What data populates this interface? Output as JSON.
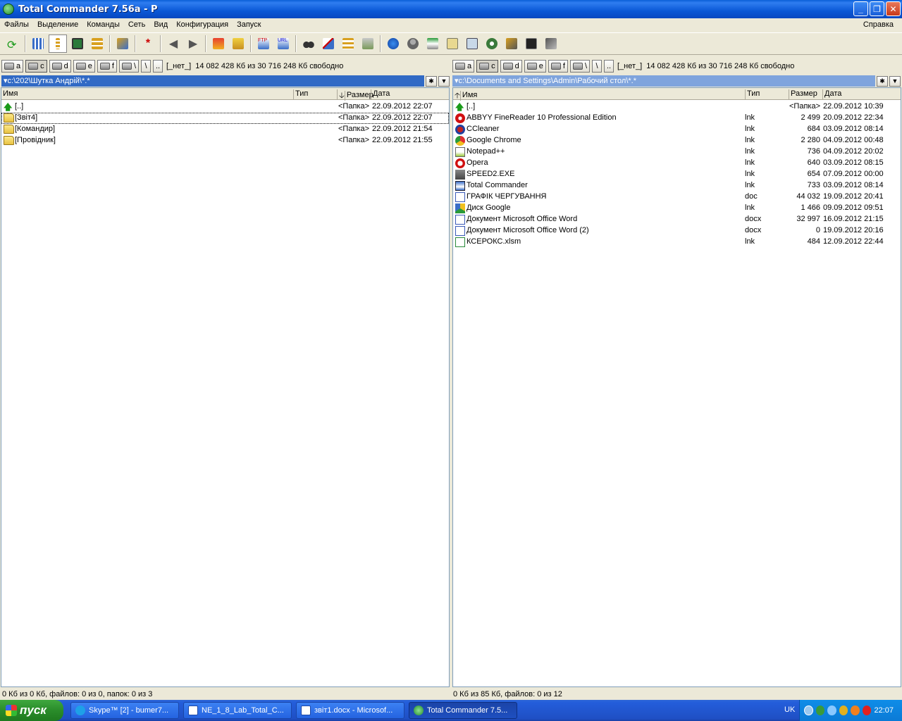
{
  "window": {
    "title": "Total Commander 7.56a - P"
  },
  "menu": [
    "Файлы",
    "Выделение",
    "Команды",
    "Сеть",
    "Вид",
    "Конфигурация",
    "Запуск"
  ],
  "menu_help": "Справка",
  "drives": {
    "labels": [
      "a",
      "c",
      "d",
      "e",
      "f",
      "\\"
    ],
    "root_btn": "\\",
    "up_btn": "..",
    "volume": "[_нет_]",
    "free": "14 082 428 Кб из 30 716 248 Кб свободно"
  },
  "columns": {
    "name": "Имя",
    "type": "Тип",
    "size": "Размер",
    "date": "Дата"
  },
  "left": {
    "path": "c:\\202\\Шутка Андрій\\*.*",
    "rows": [
      {
        "name": "[..]",
        "type": "",
        "size": "<Папка>",
        "date": "22.09.2012 22:07"
      },
      {
        "name": "[Звіт4]",
        "type": "",
        "size": "<Папка>",
        "date": "22.09.2012 22:07"
      },
      {
        "name": "[Командир]",
        "type": "",
        "size": "<Папка>",
        "date": "22.09.2012 21:54"
      },
      {
        "name": "[Провідник]",
        "type": "",
        "size": "<Папка>",
        "date": "22.09.2012 21:55"
      }
    ],
    "status": "0 Кб из 0 Кб, файлов: 0 из 0, папок: 0 из 3"
  },
  "right": {
    "path": "c:\\Documents and Settings\\Admin\\Рабочий стол\\*.*",
    "rows": [
      {
        "name": "[..]",
        "type": "",
        "size": "<Папка>",
        "date": "22.09.2012 10:39"
      },
      {
        "name": "ABBYY FineReader 10 Professional Edition",
        "type": "lnk",
        "size": "2 499",
        "date": "20.09.2012 22:34"
      },
      {
        "name": "CCleaner",
        "type": "lnk",
        "size": "684",
        "date": "03.09.2012 08:14"
      },
      {
        "name": "Google Chrome",
        "type": "lnk",
        "size": "2 280",
        "date": "04.09.2012 00:48"
      },
      {
        "name": "Notepad++",
        "type": "lnk",
        "size": "736",
        "date": "04.09.2012 20:02"
      },
      {
        "name": "Opera",
        "type": "lnk",
        "size": "640",
        "date": "03.09.2012 08:15"
      },
      {
        "name": "SPEED2.EXE",
        "type": "lnk",
        "size": "654",
        "date": "07.09.2012 00:00"
      },
      {
        "name": "Total Commander",
        "type": "lnk",
        "size": "733",
        "date": "03.09.2012 08:14"
      },
      {
        "name": "ГРАФІК ЧЕРГУВАННЯ",
        "type": "doc",
        "size": "44 032",
        "date": "19.09.2012 20:41"
      },
      {
        "name": "Диск Google",
        "type": "lnk",
        "size": "1 466",
        "date": "09.09.2012 09:51"
      },
      {
        "name": "Документ Microsoft Office Word",
        "type": "docx",
        "size": "32 997",
        "date": "16.09.2012 21:15"
      },
      {
        "name": "Документ Microsoft Office Word (2)",
        "type": "docx",
        "size": "0",
        "date": "19.09.2012 20:16"
      },
      {
        "name": "КСЕРОКС.xlsm",
        "type": "lnk",
        "size": "484",
        "date": "12.09.2012 22:44"
      }
    ],
    "status": "0 Кб из 85 Кб, файлов: 0 из 12"
  },
  "taskbar": {
    "start": "пуск",
    "tasks": [
      "Skype™ [2] - bumer7...",
      "NE_1_8_Lab_Total_C...",
      "звіт1.docx - Microsof...",
      "Total Commander 7.5..."
    ],
    "lang": "UK",
    "clock": "22:07"
  },
  "colors": {
    "path_active": "#316ac5",
    "path_inactive": "#7fa4dd",
    "titlebar": "#0a58d6",
    "start": "#2a8c2a"
  }
}
